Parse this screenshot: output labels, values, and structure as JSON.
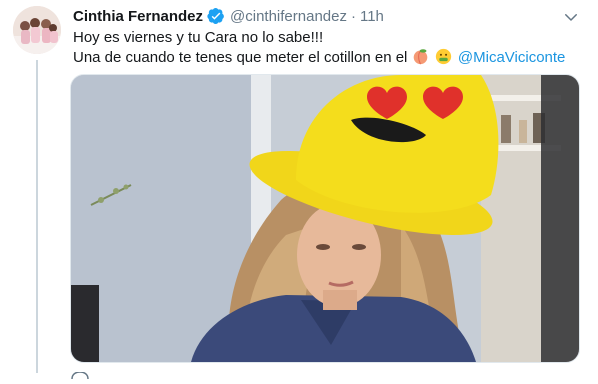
{
  "tweet": {
    "author_name": "Cinthia Fernandez",
    "handle": "@cinthifernandez",
    "separator": "·",
    "time": "11h",
    "text_line1": "Hoy es viernes y tu Cara no lo sabe!!!",
    "text_line2": "Una de cuando te tenes que meter el cotillon en el",
    "mention": "@MicaViciconte",
    "emojis": [
      "peach-emoji",
      "money-mouth-emoji"
    ],
    "media_description_icons": [
      "yellow-heart-eyes-emoji-hat"
    ]
  },
  "colors": {
    "link": "#1b95e0",
    "secondary_text": "#657786",
    "verified": "#1da1f2",
    "hat_yellow": "#f4dd1c",
    "hat_red": "#e0312b",
    "thread_line": "#ccd6dd"
  }
}
